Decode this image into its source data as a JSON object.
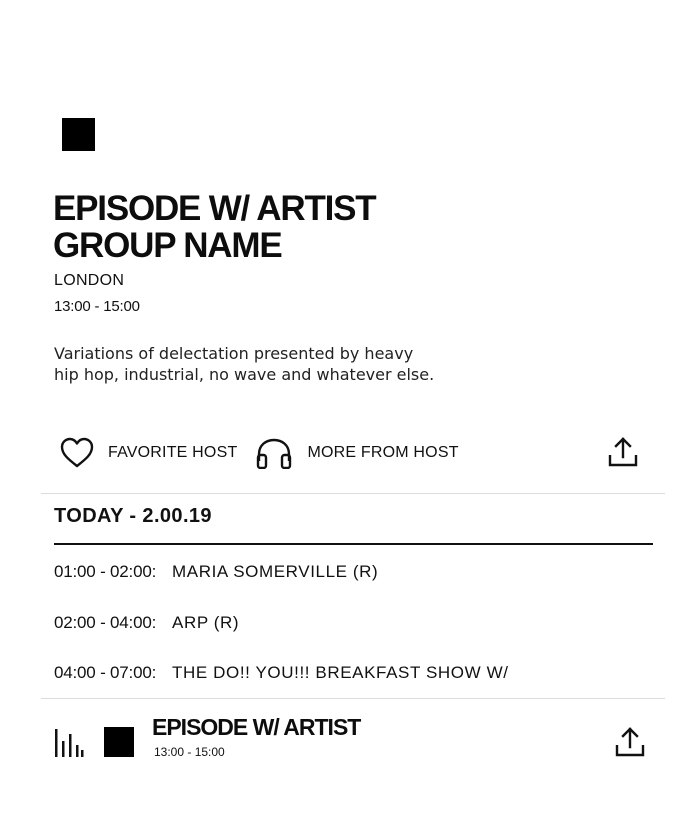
{
  "episode": {
    "title_line1": "EPISODE W/ ARTIST",
    "title_line2": "GROUP NAME",
    "location": "LONDON",
    "time": "13:00 - 15:00",
    "description_line1": "Variations of delectation presented by heavy",
    "description_line2": "hip hop, industrial, no wave and whatever else."
  },
  "actions": {
    "favorite_label": "FAVORITE HOST",
    "more_label": "MORE FROM HOST"
  },
  "schedule": {
    "heading": "TODAY - 2.00.19",
    "rows": [
      {
        "slot": "01:00 - 02:00:",
        "show": "MARIA SOMERVILLE (R)"
      },
      {
        "slot": "02:00 - 04:00:",
        "show": "ARP (R)"
      },
      {
        "slot": "04:00 - 07:00:",
        "show": "THE DO!! YOU!!! BREAKFAST SHOW W/"
      }
    ]
  },
  "player": {
    "title": "EPISODE W/ ARTIST",
    "time": "13:00 - 15:00"
  },
  "icons": {
    "favorite": "heart-icon",
    "more": "headphones-icon",
    "share": "share-icon",
    "equalizer": "equalizer-icon"
  }
}
